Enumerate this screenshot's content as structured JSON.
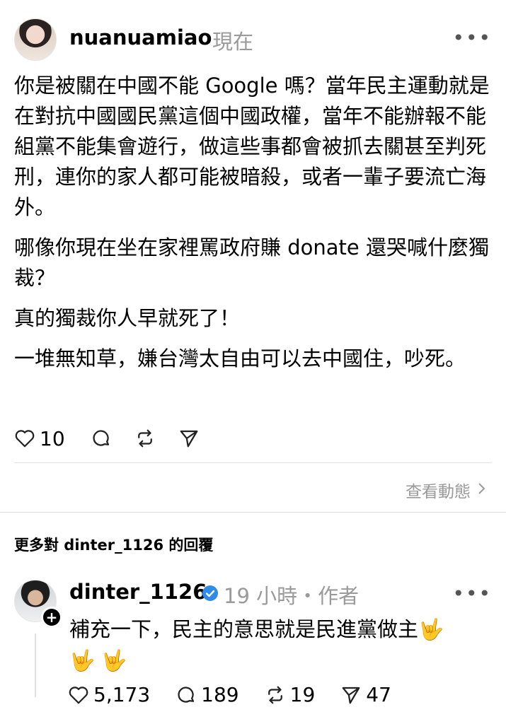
{
  "post": {
    "username": "nuanuamiao",
    "time": "現在",
    "paragraphs": [
      "你是被關在中國不能 Google 嗎？當年民主運動就是在對抗中國國民黨這個中國政權，當年不能辦報不能組黨不能集會遊行，做這些事都會被抓去關甚至判死刑，連你的家人都可能被暗殺，或者一輩子要流亡海外。",
      "哪像你現在坐在家裡罵政府賺 donate 還哭喊什麼獨裁？",
      "真的獨裁你人早就死了！",
      "一堆無知草，嫌台灣太自由可以去中國住，吵死。"
    ],
    "likes": "10",
    "view_activity": "查看動態",
    "more_icon": "more-icon"
  },
  "section": {
    "more_replies": "更多對 dinter_1126 的回覆"
  },
  "reply": {
    "username": "dinter_1126",
    "meta": "19 小時・作者",
    "text": "補充一下，民主的意思就是民進黨做主",
    "emojis": [
      "🤟",
      "🤟",
      "🤟"
    ],
    "likes": "5,173",
    "comments": "189",
    "reposts": "19",
    "shares": "47",
    "verified_color": "#2f8be8"
  }
}
